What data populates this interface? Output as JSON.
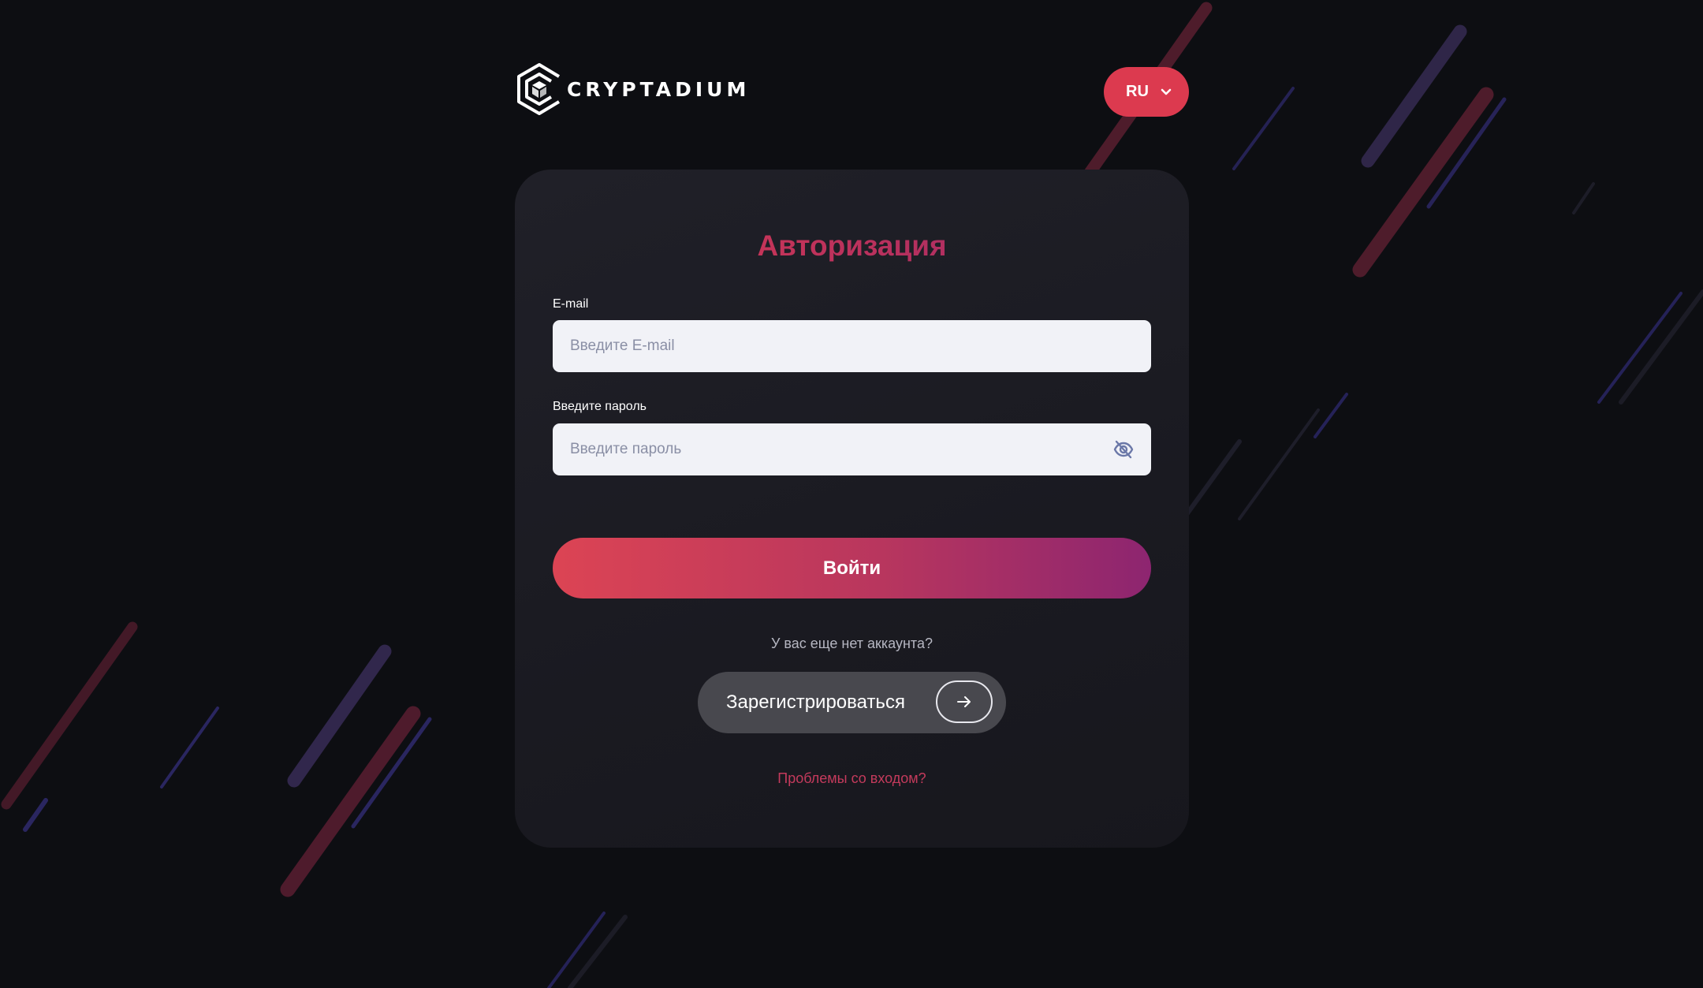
{
  "brand": {
    "name": "CRYPTADIUM",
    "icon": "cube-hexagon-logo-icon"
  },
  "language": {
    "selected": "RU",
    "icon": "chevron-down-icon"
  },
  "auth": {
    "title": "Авторизация",
    "email_label": "E-mail",
    "email_placeholder": "Введите E-mail",
    "password_label": "Введите пароль",
    "password_placeholder": "Введите пароль",
    "password_toggle_icon": "eye-off-icon",
    "submit_label": "Войти",
    "no_account_text": "У вас еще нет аккаунта?",
    "register_label": "Зарегистрироваться",
    "register_icon": "arrow-right-icon",
    "trouble_link": "Проблемы со входом?"
  },
  "colors": {
    "background": "#0d0e12",
    "card": "#1e1e25",
    "accent_red": "#dc3a4f",
    "accent_purple": "#8d2570",
    "input_bg": "#f1f2f7",
    "register_bg": "#48484e"
  }
}
